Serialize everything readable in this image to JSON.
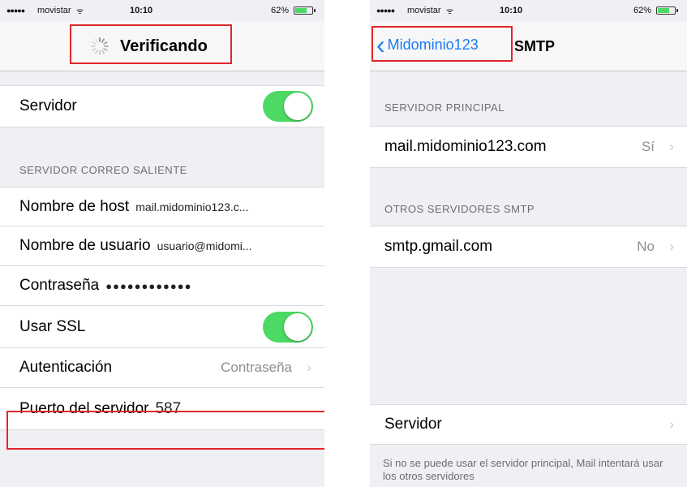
{
  "left_screen": {
    "status": {
      "signal": "●●●●●",
      "carrier": "movistar",
      "wifi": "ᯤ",
      "time": "10:10",
      "battery": "62%"
    },
    "nav": {
      "title": "Verificando"
    },
    "servidor": {
      "label": "Servidor",
      "enabled": true
    },
    "section_header": "SERVIDOR CORREO SALIENTE",
    "fields": {
      "host_label": "Nombre de host",
      "host_value": "mail.midominio123.c...",
      "user_label": "Nombre de usuario",
      "user_value": "usuario@midomi...",
      "password_label": "Contraseña",
      "password_value": "●●●●●●●●●●●●",
      "ssl_label": "Usar SSL",
      "ssl_enabled": true,
      "auth_label": "Autenticación",
      "auth_value": "Contraseña",
      "port_label": "Puerto del servidor",
      "port_value": "587"
    },
    "chevron": "›"
  },
  "right_screen": {
    "status": {
      "signal": "●●●●●",
      "carrier": "movistar",
      "wifi": "ᯤ",
      "time": "10:10",
      "battery": "62%"
    },
    "nav": {
      "back_label": "Midominio123",
      "back_icon": "‹",
      "title": "SMTP"
    },
    "primary_header": "SERVIDOR PRINCIPAL",
    "primary_server": {
      "name": "mail.midominio123.com",
      "status": "Sí"
    },
    "others_header": "OTROS SERVIDORES SMTP",
    "other_server": {
      "name": "smtp.gmail.com",
      "status": "No"
    },
    "servidor_label": "Servidor",
    "footer": "Si no se puede usar el servidor principal, Mail intentará usar los otros servidores",
    "chevron": "›"
  },
  "colors": {
    "highlight": "#e0262b",
    "toggle_on": "#4cd964",
    "link_blue": "#1a7cf5"
  }
}
